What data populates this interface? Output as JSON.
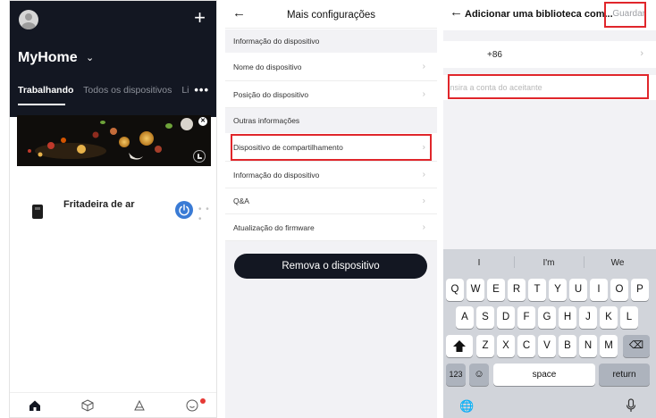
{
  "screen_home": {
    "home_name": "MyHome",
    "home_caret": "⌄",
    "add_icon": "+",
    "tabs": [
      "Trabalhando",
      "Todos os dispositivos",
      "Li"
    ],
    "more_label": "•••",
    "banner_close": "✕",
    "device": {
      "name": "Fritadeira de ar",
      "more": "• • •"
    },
    "nav_icons": [
      "home-icon",
      "cube-icon",
      "scene-icon",
      "profile-icon"
    ],
    "colors": {
      "header_bg": "#131722",
      "power_button": "#3a7bd5",
      "notification_dot": "#e53935"
    }
  },
  "screen_settings": {
    "back_icon": "←",
    "title": "Mais configurações",
    "section_device_info": "Informação do dispositivo",
    "rows_device_info": [
      "Nome do dispositivo",
      "Posição do dispositivo"
    ],
    "section_other": "Outras informações",
    "rows_other": [
      "Dispositivo de compartilhamento",
      "Informação do dispositivo",
      "Q&A",
      "Atualização do firmware"
    ],
    "remove_button": "Remova o dispositivo",
    "chevron": "›",
    "colors": {
      "highlight": "#e0262b",
      "button_bg": "#131722"
    }
  },
  "screen_share": {
    "back_icon": "←",
    "title": "Adicionar uma biblioteca com...",
    "save_button": "Guardar",
    "country_code": "+86",
    "chevron": "›",
    "account_placeholder": "Insira a conta do aceitante",
    "account_value": "",
    "keyboard": {
      "suggestions": [
        "I",
        "I'm",
        "We"
      ],
      "row1": [
        "Q",
        "W",
        "E",
        "R",
        "T",
        "Y",
        "U",
        "I",
        "O",
        "P"
      ],
      "row2": [
        "A",
        "S",
        "D",
        "F",
        "G",
        "H",
        "J",
        "K",
        "L"
      ],
      "row3": [
        "Z",
        "X",
        "C",
        "V",
        "B",
        "N",
        "M"
      ],
      "shift_icon": "shift-icon",
      "backspace_icon": "⌫",
      "numbers_key": "123",
      "emoji_key": "☺",
      "space_key": "space",
      "return_key": "return",
      "globe_icon": "🌐",
      "mic_icon": "microphone-icon"
    }
  }
}
